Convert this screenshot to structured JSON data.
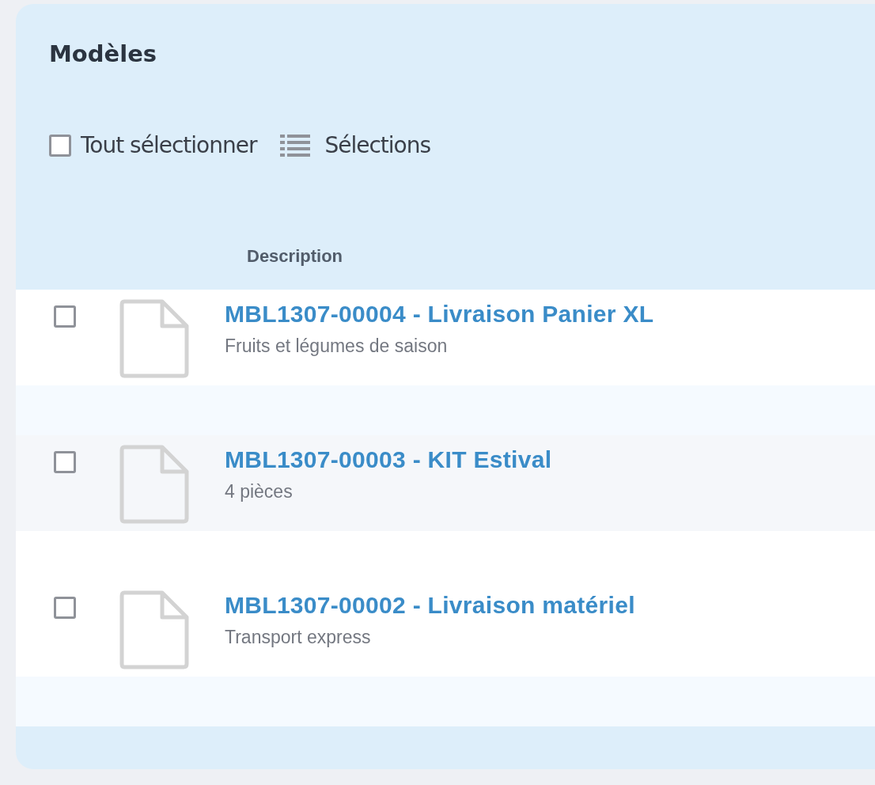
{
  "panel": {
    "title": "Modèles"
  },
  "toolbar": {
    "select_all": {
      "label": "Tout sélectionner",
      "checked": false
    },
    "selections": {
      "label": "Sélections"
    }
  },
  "table": {
    "columns": [
      "Description"
    ],
    "rows": [
      {
        "title": "MBL1307-00004 - Livraison Panier XL",
        "subtitle": "Fruits et légumes de saison",
        "checked": false
      },
      {
        "title": "MBL1307-00003 - KIT Estival",
        "subtitle": "4 pièces",
        "checked": false
      },
      {
        "title": "MBL1307-00002 - Livraison matériel",
        "subtitle": "Transport express",
        "checked": false
      }
    ]
  }
}
